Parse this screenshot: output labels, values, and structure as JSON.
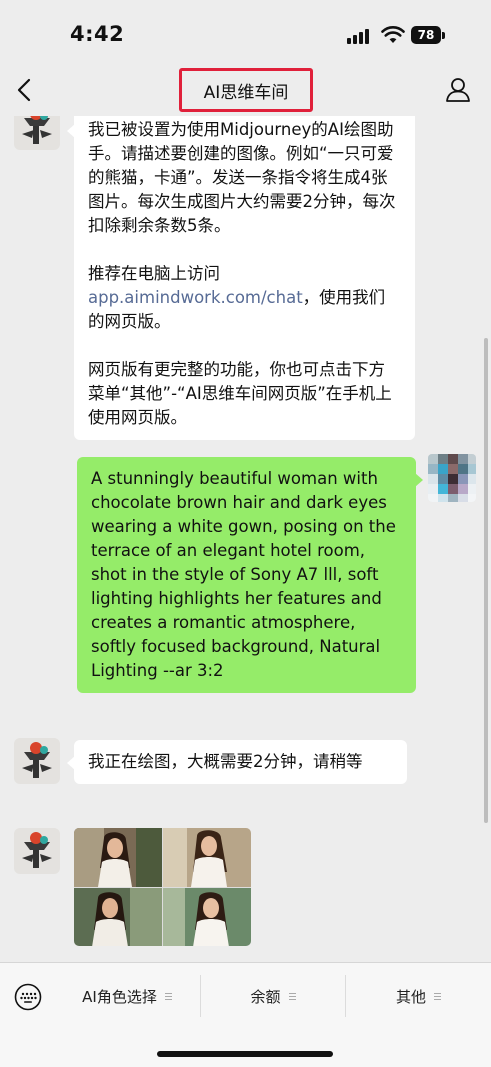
{
  "status_bar": {
    "time": "4:42",
    "battery": "78"
  },
  "nav": {
    "title": "AI思维车间",
    "back_icon": "chevron-left-icon",
    "profile_icon": "person-icon"
  },
  "messages": {
    "intro": {
      "para1": "我已被设置为使用Midjourney的AI绘图助手。请描述要创建的图像。例如“一只可爱的熊猫，卡通”。发送一条指令将生成4张图片。每次生成图片大约需要2分钟，每次扣除剩余条数5条。",
      "para2_prefix": "推荐在电脑上访问",
      "para2_link": "app.aimindwork.com/chat",
      "para2_suffix": "，使用我们的网页版。",
      "para3": "网页版有更完整的功能，你也可点击下方菜单“其他”-“AI思维车间网页版”在手机上使用网页版。"
    },
    "user_prompt": "A stunningly beautiful woman with chocolate brown hair and dark eyes wearing a white gown, posing on the terrace of an elegant hotel room, shot in the style of Sony A7 lll, soft lighting highlights her features and creates a romantic atmosphere, softly focused background, Natural Lighting --ar 3:2",
    "drawing_status": "我正在绘图，大概需要2分钟，请稍等"
  },
  "bottom_menu": {
    "item1": "AI角色选择",
    "item2": "余额",
    "item3": "其他",
    "keyboard_icon": "keyboard-icon"
  },
  "colors": {
    "background": "#ededed",
    "my_bubble": "#95ec69",
    "bot_bubble": "#ffffff",
    "link": "#576b95",
    "highlight_box": "#e0203a"
  }
}
